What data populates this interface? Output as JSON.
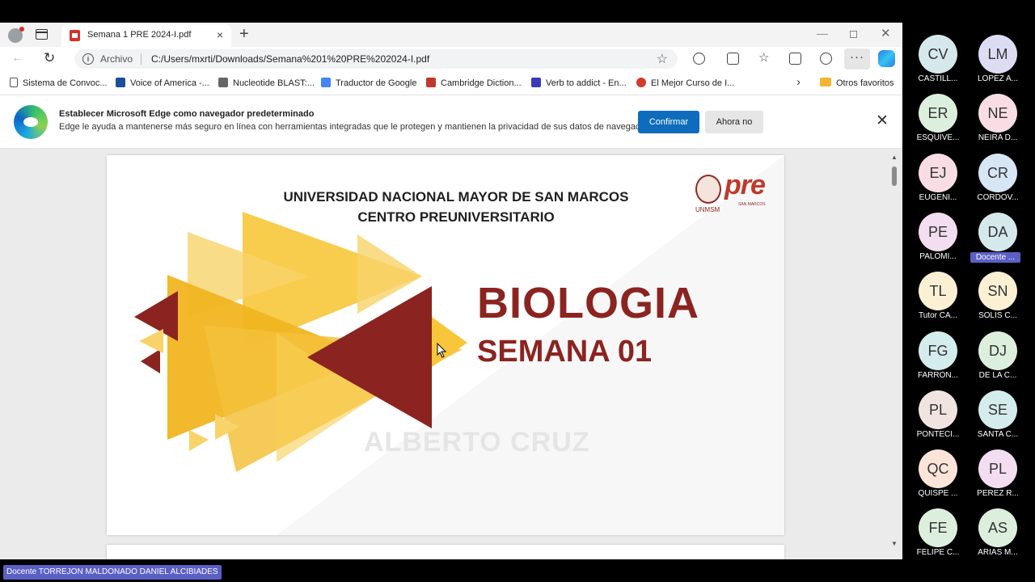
{
  "browser": {
    "tab_title": "Semana 1 PRE 2024-I.pdf",
    "tab_close": "×",
    "new_tab": "+",
    "address_label": "Archivo",
    "address_url": "C:/Users/mxrti/Downloads/Semana%201%20PRE%202024-I.pdf",
    "more_label": "···"
  },
  "bookmarks": [
    {
      "label": "Sistema de Convoc...",
      "icon": "page-icon",
      "color": "#555555"
    },
    {
      "label": "Voice of America -...",
      "icon": "voa-icon",
      "color": "#1a4f9c"
    },
    {
      "label": "Nucleotide BLAST:...",
      "icon": "blast-icon",
      "color": "#555555"
    },
    {
      "label": "Traductor de Google",
      "icon": "translate-icon",
      "color": "#4285f4"
    },
    {
      "label": "Cambridge Diction...",
      "icon": "cambridge-icon",
      "color": "#c0392b"
    },
    {
      "label": "Verb to addict - En...",
      "icon": "grid-icon",
      "color": "#3b3bb5"
    },
    {
      "label": "El Mejor Curso de I...",
      "icon": "course-icon",
      "color": "#d33a2c"
    }
  ],
  "other_favorites": "Otros favoritos",
  "infobar": {
    "title": "Establecer Microsoft Edge como navegador predeterminado",
    "text": "Edge le ayuda a mantenerse más seguro en línea con herramientas integradas que le protegen y mantienen la privacidad de sus datos de navegación",
    "confirm": "Confirmar",
    "later": "Ahora no",
    "close": "✕"
  },
  "slide": {
    "line1": "UNIVERSIDAD NACIONAL MAYOR DE SAN MARCOS",
    "line2": "CENTRO PREUNIVERSITARIO",
    "logo_text": "pre",
    "logo_small": "SAN MARCOS",
    "seal_text": "UNMSM",
    "title": "BIOLOGIA",
    "subtitle": "SEMANA 01",
    "watermark": "ALBERTO CRUZ"
  },
  "participants": [
    {
      "initials": "CV",
      "name": "CASTILL...",
      "color": "#d5e8ec"
    },
    {
      "initials": "LM",
      "name": "LOPEZ A...",
      "color": "#dcdcf3"
    },
    {
      "initials": "ER",
      "name": "ESQUIVE...",
      "color": "#dcefdc"
    },
    {
      "initials": "NE",
      "name": "NEIRA D...",
      "color": "#f8dde4"
    },
    {
      "initials": "EJ",
      "name": "EUGENI...",
      "color": "#f8dde4"
    },
    {
      "initials": "CR",
      "name": "CORDOV...",
      "color": "#d6e6f5"
    },
    {
      "initials": "PE",
      "name": "PALOMI...",
      "color": "#f3ddf0"
    },
    {
      "initials": "DA",
      "name": "Docente ...",
      "color": "#d5e8ec",
      "highlight": true
    },
    {
      "initials": "TL",
      "name": "Tutor CA...",
      "color": "#fbf0d4"
    },
    {
      "initials": "SN",
      "name": "SOLIS C...",
      "color": "#fbf0d4"
    },
    {
      "initials": "FG",
      "name": "FARRON...",
      "color": "#d5ecec"
    },
    {
      "initials": "DJ",
      "name": "DE LA C...",
      "color": "#dcefdc"
    },
    {
      "initials": "PL",
      "name": "PONTECI...",
      "color": "#f1e4e0"
    },
    {
      "initials": "SE",
      "name": "SANTA C...",
      "color": "#d5ecec"
    },
    {
      "initials": "QC",
      "name": "QUISPE ...",
      "color": "#fde4d8"
    },
    {
      "initials": "PL",
      "name": "PEREZ R...",
      "color": "#f3ddf0"
    },
    {
      "initials": "FE",
      "name": "FELIPE C...",
      "color": "#dcefdc"
    },
    {
      "initials": "AS",
      "name": "ARIAS M...",
      "color": "#dcefdc"
    }
  ],
  "presenter_label": "Docente TORREJON MALDONADO DANIEL ALCIBIADES"
}
